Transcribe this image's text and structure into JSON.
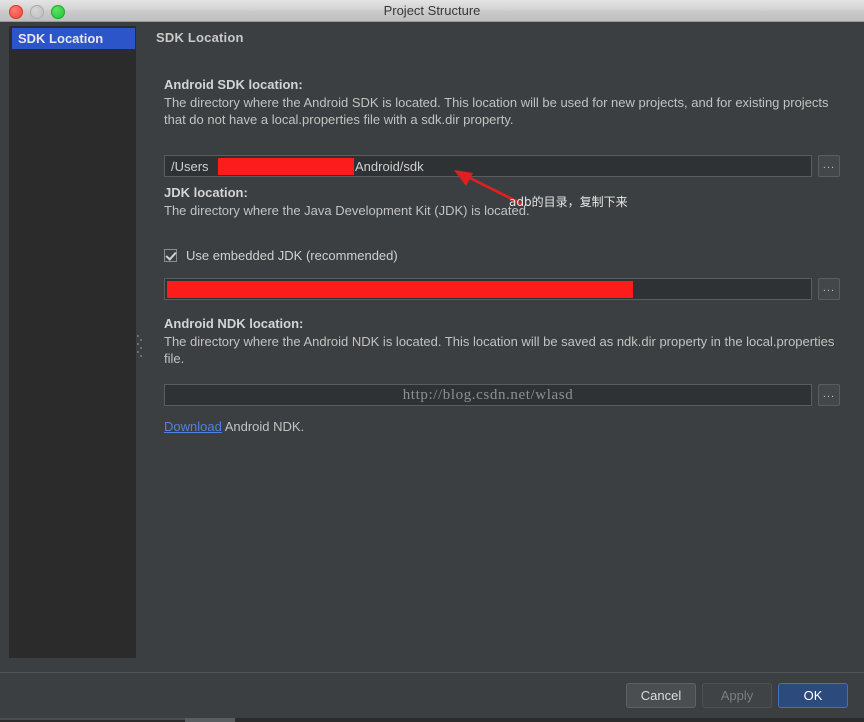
{
  "window": {
    "title": "Project Structure",
    "traffic_lights": [
      "close-button",
      "minimize-button",
      "zoom-button"
    ]
  },
  "sidebar": {
    "items": [
      {
        "label": "SDK Location",
        "selected": true
      }
    ]
  },
  "content": {
    "pane_title": "SDK Location",
    "sections": [
      {
        "id": "android-sdk",
        "label": "Android SDK location:",
        "description": "The directory where the Android SDK is located. This location will be used for new projects, and for existing projects that do not have a local.properties file with a sdk.dir property.",
        "field_value_prefix": "/Users",
        "field_value_suffix": "Android/sdk",
        "browse_label": "...",
        "redacted": true
      },
      {
        "id": "jdk",
        "label": "JDK location:",
        "description": "The directory where the Java Development Kit (JDK) is located.",
        "checkbox_label": "Use embedded JDK (recommended)",
        "checkbox_checked": true,
        "field_value": "",
        "browse_label": "...",
        "redacted": true
      },
      {
        "id": "android-ndk",
        "label": "Android NDK location:",
        "description": "The directory where the Android NDK is located. This location will be saved as ndk.dir property in the local.properties file.",
        "field_value": "",
        "watermark": "http://blog.csdn.net/wlasd",
        "browse_label": "...",
        "download_link": "Download",
        "download_rest": " Android NDK."
      }
    ]
  },
  "annotation": {
    "text": "adb的目录，复制下来",
    "arrow_color": "#e02020"
  },
  "footer": {
    "buttons": [
      {
        "label": "Cancel",
        "state": "enabled"
      },
      {
        "label": "Apply",
        "state": "disabled"
      },
      {
        "label": "OK",
        "state": "default"
      }
    ]
  },
  "colors": {
    "accent_selection": "#2b55c9",
    "redaction": "#fc1c1c",
    "link": "#4f82e0",
    "ok_button": "#2c4a7c"
  }
}
